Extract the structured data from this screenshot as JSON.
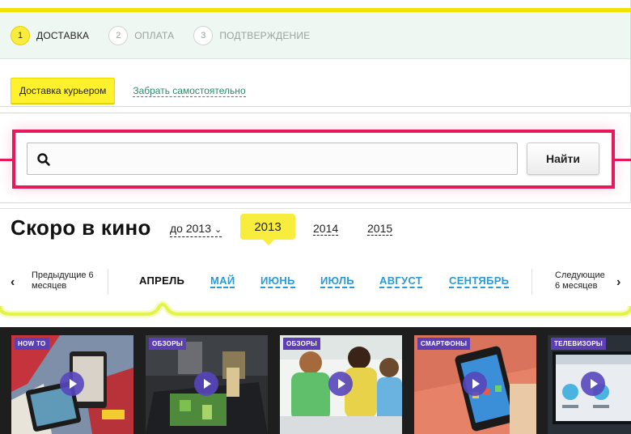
{
  "checkout": {
    "steps": [
      {
        "num": "1",
        "label": "ДОСТАВКА",
        "active": true
      },
      {
        "num": "2",
        "label": "ОПЛАТА",
        "active": false
      },
      {
        "num": "3",
        "label": "ПОДТВЕРЖДЕНИЕ",
        "active": false
      }
    ],
    "delivery_courier": "Доставка курьером",
    "delivery_self": "Забрать самостоятельно"
  },
  "search": {
    "placeholder": "",
    "button_label": "Найти"
  },
  "movies": {
    "title": "Скоро в кино",
    "year_dropdown": "до 2013",
    "year_selected": "2013",
    "year_2014": "2014",
    "year_2015": "2015",
    "prev_label": "Предыдущие 6 месяцев",
    "next_label": "Следующие 6 месяцев",
    "months": [
      "АПРЕЛЬ",
      "МАЙ",
      "ИЮНЬ",
      "ИЮЛЬ",
      "АВГУСТ",
      "СЕНТЯБРЬ"
    ],
    "active_month": "АПРЕЛЬ"
  },
  "videos": [
    {
      "tag": "HOW TO"
    },
    {
      "tag": "ОБЗОРЫ"
    },
    {
      "tag": "ОБЗОРЫ"
    },
    {
      "tag": "СМАРТФОНЫ"
    },
    {
      "tag": "ТЕЛЕВИЗОРЫ"
    }
  ],
  "colors": {
    "accent_yellow": "#f8ec3c",
    "search_frame": "#e8195a",
    "lime": "#e3f34a",
    "link_blue": "#2b9ad6",
    "tag_purple": "#5b3fb3"
  }
}
